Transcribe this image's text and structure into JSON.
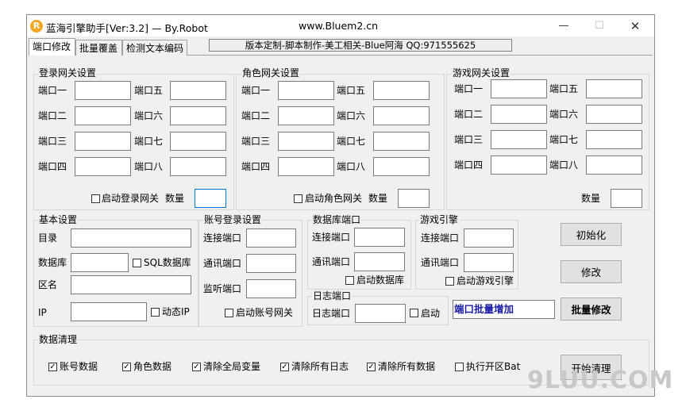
{
  "window": {
    "title": "蓝海引擎助手[Ver:3.2] — By.Robot",
    "url": "www.Bluem2.cn",
    "minimize": "—",
    "maximize": "☐",
    "close": "✕",
    "icon": "app-logo-icon"
  },
  "tabs": [
    "端口修改",
    "批量覆盖",
    "检测文本编码"
  ],
  "banner": "版本定制-脚本制作-美工相关-Blue阿海  QQ:971555625",
  "login_gateway": {
    "title": "登录网关设置",
    "ports": [
      "端口一",
      "端口二",
      "端口三",
      "端口四",
      "端口五",
      "端口六",
      "端口七",
      "端口八"
    ],
    "enable": "启动登录网关",
    "count": "数量"
  },
  "role_gateway": {
    "title": "角色网关设置",
    "ports": [
      "端口一",
      "端口二",
      "端口三",
      "端口四",
      "端口五",
      "端口六",
      "端口七",
      "端口八"
    ],
    "enable": "启动角色网关",
    "count": "数量"
  },
  "game_gateway": {
    "title": "游戏网关设置",
    "ports": [
      "端口一",
      "端口二",
      "端口三",
      "端口四",
      "端口五",
      "端口六",
      "端口七",
      "端口八"
    ],
    "count": "数量"
  },
  "basic": {
    "title": "基本设置",
    "dir": "目录",
    "db": "数据库",
    "sql": "SQL数据库",
    "region": "区名",
    "ip": "IP",
    "dynamic_ip": "动态IP"
  },
  "account_login": {
    "title": "账号登录设置",
    "connect": "连接端口",
    "comm": "通讯端口",
    "listen": "监听端口",
    "enable": "启动账号网关"
  },
  "db_port": {
    "title": "数据库端口",
    "connect": "连接端口",
    "comm": "通讯端口",
    "enable": "启动数据库"
  },
  "game_engine": {
    "title": "游戏引擎",
    "connect": "连接端口",
    "comm": "通讯端口",
    "enable": "启动游戏引擎"
  },
  "log_port": {
    "title": "日志端口",
    "port": "日志端口",
    "enable": "启动"
  },
  "buttons": {
    "init": "初始化",
    "modify": "修改",
    "batch_field": "端口批量增加",
    "batch_modify": "批量修改",
    "start_clean": "开始清理"
  },
  "cleanup": {
    "title": "数据清理",
    "items": [
      {
        "label": "账号数据",
        "checked": true
      },
      {
        "label": "角色数据",
        "checked": true
      },
      {
        "label": "清除全局变量",
        "checked": true
      },
      {
        "label": "清除所有日志",
        "checked": true
      },
      {
        "label": "清除所有数据",
        "checked": true
      },
      {
        "label": "执行开区Bat",
        "checked": false
      }
    ]
  },
  "watermark": "9LUU.COM"
}
